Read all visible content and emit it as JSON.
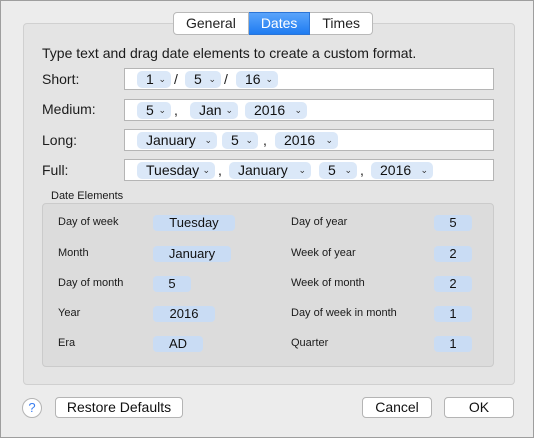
{
  "tabs": [
    {
      "label": "General"
    },
    {
      "label": "Dates",
      "active": true
    },
    {
      "label": "Times"
    }
  ],
  "instructions": "Type text and drag date elements to create a custom format.",
  "formats": {
    "short": {
      "label": "Short:",
      "tokens": [
        "1",
        "5",
        "16"
      ],
      "separators": [
        "/",
        "/"
      ]
    },
    "medium": {
      "label": "Medium:",
      "tokens": [
        "5",
        "Jan",
        "2016"
      ],
      "separators": [
        ","
      ]
    },
    "long": {
      "label": "Long:",
      "tokens": [
        "January",
        "5",
        "2016"
      ],
      "separators": [
        ","
      ]
    },
    "full": {
      "label": "Full:",
      "tokens": [
        "Tuesday",
        "January",
        "5",
        "2016"
      ],
      "separators": [
        ",",
        ","
      ]
    }
  },
  "date_elements": {
    "title": "Date Elements",
    "left": [
      {
        "label": "Day of week",
        "value": "Tuesday"
      },
      {
        "label": "Month",
        "value": "January"
      },
      {
        "label": "Day of month",
        "value": "5"
      },
      {
        "label": "Year",
        "value": "2016"
      },
      {
        "label": "Era",
        "value": "AD"
      }
    ],
    "right": [
      {
        "label": "Day of year",
        "value": "5"
      },
      {
        "label": "Week of year",
        "value": "2"
      },
      {
        "label": "Week of month",
        "value": "2"
      },
      {
        "label": "Day of week in month",
        "value": "1"
      },
      {
        "label": "Quarter",
        "value": "1"
      }
    ]
  },
  "buttons": {
    "help": "?",
    "restore": "Restore Defaults",
    "cancel": "Cancel",
    "ok": "OK"
  },
  "icons": {
    "chevron": "chevron-down-icon",
    "help": "help-icon"
  },
  "colors": {
    "accent": "#1f7cf1",
    "token_bg": "#dbe8f8"
  }
}
